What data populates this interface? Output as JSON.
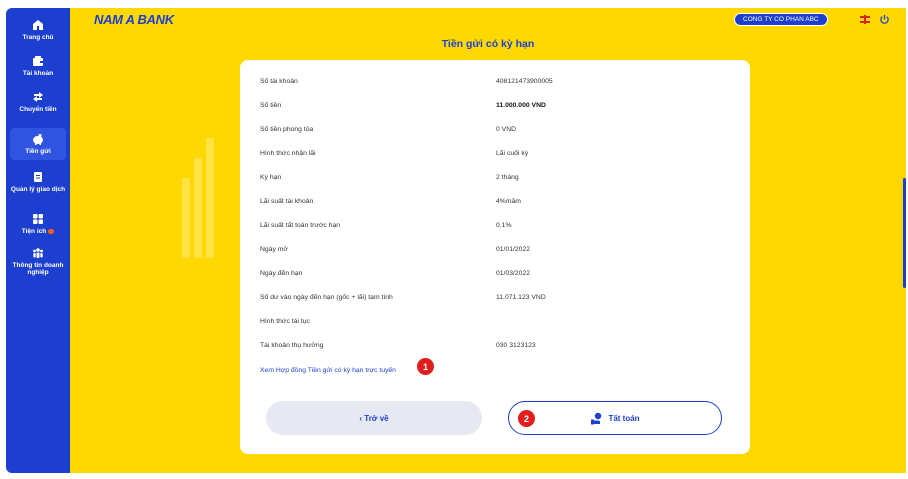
{
  "brand": {
    "name": "NAM A BANK"
  },
  "header": {
    "company": "CONG TY CO PHAN ABC",
    "title": "Tiền gửi có kỳ hạn"
  },
  "sidebar": {
    "items": [
      {
        "label": "Trang chủ",
        "icon": "home-icon"
      },
      {
        "label": "Tài khoản",
        "icon": "wallet-icon"
      },
      {
        "label": "Chuyển tiền",
        "icon": "transfer-icon"
      },
      {
        "label": "Tiền gửi",
        "icon": "piggy-bank-icon"
      },
      {
        "label": "Quản lý giao dịch",
        "icon": "document-icon"
      },
      {
        "label": "Tiện ích",
        "icon": "grid-icon"
      },
      {
        "label": "Thông tin doanh nghiệp",
        "icon": "people-icon"
      }
    ]
  },
  "details": [
    {
      "label": "Số tài khoản",
      "value": "408121473900005"
    },
    {
      "label": "Số tiền",
      "value": "11.000.000 VND"
    },
    {
      "label": "Số tiền phong tỏa",
      "value": "0 VND"
    },
    {
      "label": "Hình thức nhận lãi",
      "value": "Lãi cuối kỳ"
    },
    {
      "label": "Kỳ hạn",
      "value": "2 tháng"
    },
    {
      "label": "Lãi suất tài khoản",
      "value": "4%/năm"
    },
    {
      "label": "Lãi suất tất toán trước hạn",
      "value": "0.1%"
    },
    {
      "label": "Ngày mở",
      "value": "01/01/2022"
    },
    {
      "label": "Ngày đến hạn",
      "value": "01/03/2022"
    },
    {
      "label": "Số dư vào ngày đến hạn (gốc + lãi) tạm tính",
      "value": "11.071.123 VND"
    },
    {
      "label": "Hình thức tái tục",
      "value": ""
    },
    {
      "label": "Tài khoản thụ hưởng",
      "value": "030 3123123"
    }
  ],
  "contract_link": "Xem Hợp đồng Tiền gửi có kỳ hạn trực tuyến",
  "badges": {
    "one": "1",
    "two": "2"
  },
  "buttons": {
    "back": "‹ Trở về",
    "settle": "Tất toán"
  },
  "colors": {
    "primary": "#1c3fcf",
    "background": "#ffd800",
    "badge": "#e11d1d"
  }
}
